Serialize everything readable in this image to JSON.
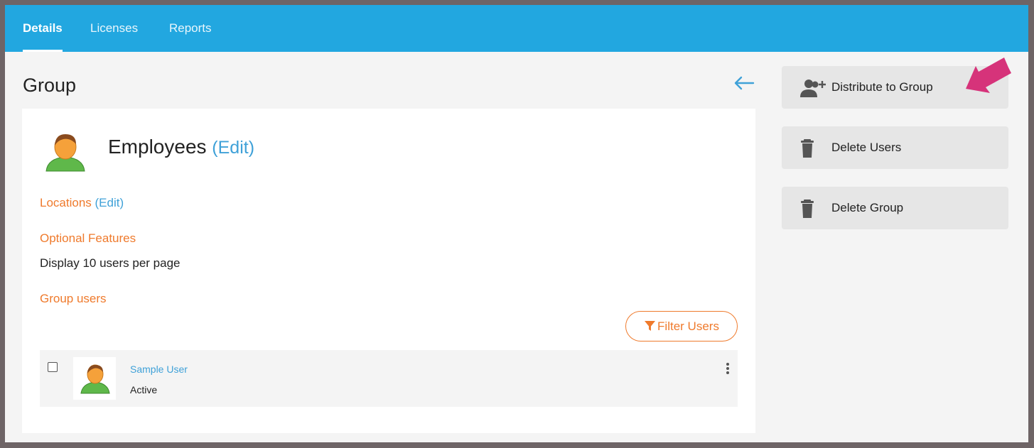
{
  "tabs": [
    {
      "label": "Details",
      "active": true
    },
    {
      "label": "Licenses",
      "active": false
    },
    {
      "label": "Reports",
      "active": false
    }
  ],
  "page": {
    "title": "Group",
    "back_icon": "arrow-left-icon"
  },
  "group": {
    "name": "Employees",
    "edit_label": "(Edit)",
    "avatar_icon": "user-avatar-icon"
  },
  "sections": {
    "locations_label": "Locations",
    "locations_edit_label": "(Edit)",
    "optional_features_label": "Optional Features",
    "display_setting": "Display 10 users per page",
    "group_users_label": "Group users"
  },
  "filter": {
    "label": "Filter Users",
    "icon": "filter-icon"
  },
  "users": [
    {
      "name": "Sample User",
      "status": "Active",
      "checked": false
    }
  ],
  "actions": [
    {
      "label": "Distribute to Group",
      "icon": "user-plus-icon"
    },
    {
      "label": "Delete Users",
      "icon": "trash-icon"
    },
    {
      "label": "Delete Group",
      "icon": "trash-icon"
    }
  ],
  "colors": {
    "topbar": "#22a7e0",
    "accent_orange": "#ef7a2c",
    "link_blue": "#3fa1d8",
    "annotation_pink": "#d6337a",
    "action_bg": "#e6e6e6"
  }
}
